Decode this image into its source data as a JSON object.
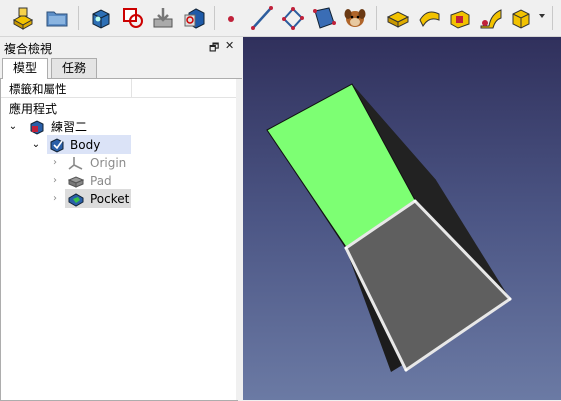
{
  "toolbar": {
    "icons": [
      "create-body-icon",
      "open-folder-icon",
      "create-part-icon",
      "subshape-binder-icon",
      "import-icon",
      "clone-icon",
      "datum-point-icon",
      "datum-line-icon",
      "datum-plane-icon",
      "local-coordinate-icon",
      "shape-binder-icon",
      "pad-icon",
      "revolution-icon",
      "additive-loft-icon",
      "additive-pipe-icon",
      "additive-primitive-icon"
    ]
  },
  "combo_view": {
    "title": "複合檢視",
    "float_symbol": "🗗",
    "close_symbol": "✕",
    "tabs": [
      "模型",
      "任務"
    ],
    "header": "標籤和屬性",
    "root_label": "應用程式",
    "tree": {
      "document": "練習二",
      "body": "Body",
      "origin": "Origin",
      "pad": "Pad",
      "pocket": "Pocket"
    }
  },
  "colors": {
    "top_face": "#7dff73",
    "pocket_face": "#5f5f5f",
    "body_selection": "#dbe3f7",
    "view_top": "#30305c",
    "view_bottom": "#6b7aa4"
  }
}
